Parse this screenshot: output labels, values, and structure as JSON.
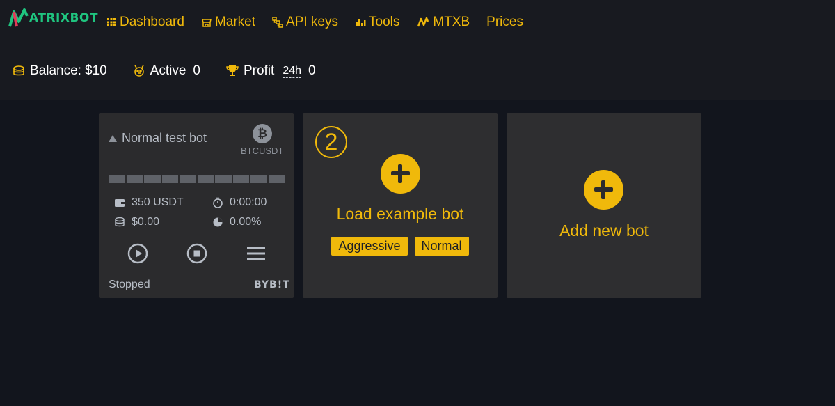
{
  "brand": {
    "name": "ATRIXBOT"
  },
  "nav": [
    {
      "label": "Dashboard",
      "icon": "grid-icon"
    },
    {
      "label": "Market",
      "icon": "shop-icon"
    },
    {
      "label": "API keys",
      "icon": "network-icon"
    },
    {
      "label": "Tools",
      "icon": "bar-chart-icon"
    },
    {
      "label": "MTXB",
      "icon": "mtxb-icon"
    },
    {
      "label": "Prices",
      "icon": ""
    }
  ],
  "stats": {
    "balance": {
      "label": "Balance:",
      "value": "$10"
    },
    "active": {
      "label": "Active",
      "value": "0"
    },
    "profit": {
      "label": "Profit",
      "timeframe": "24h",
      "value": "0"
    }
  },
  "bot_card": {
    "name": "Normal test bot",
    "coin_symbol": "₿",
    "pair": "BTCUSDT",
    "progress_segments": 10,
    "investment": "350 USDT",
    "runtime": "0:00:00",
    "profit": "$0.00",
    "profit_pct": "0.00%",
    "status": "Stopped",
    "exchange": "BYB!T"
  },
  "example_card": {
    "step": "2",
    "title": "Load example bot",
    "tags": [
      "Aggressive",
      "Normal"
    ]
  },
  "add_card": {
    "title": "Add new bot"
  },
  "colors": {
    "accent": "#f0b90b",
    "brand_green": "#1fc47f",
    "background": "#12151d",
    "header": "#181a20",
    "card": "#2b2b2d",
    "muted_text": "#b7bdc6"
  }
}
